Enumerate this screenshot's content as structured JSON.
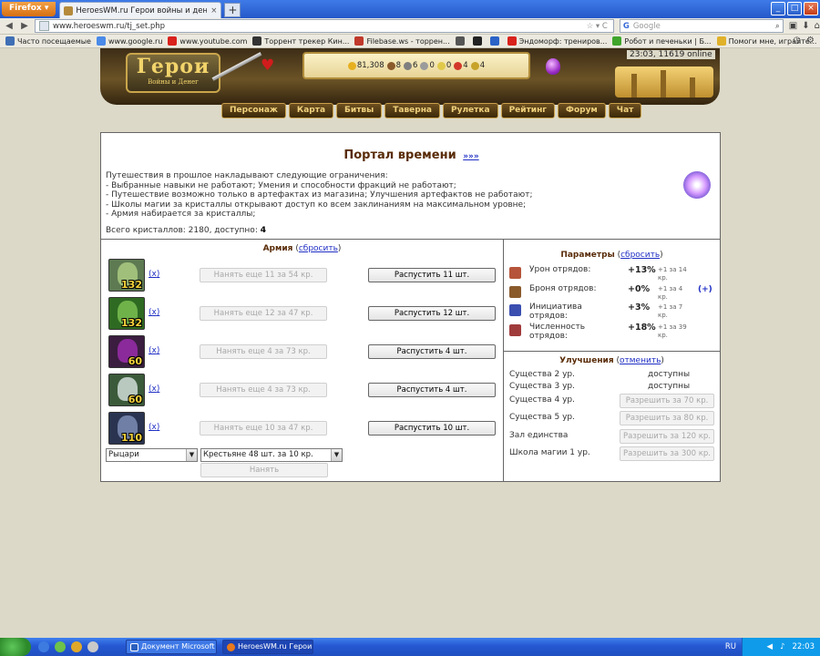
{
  "browser": {
    "app_button": "Firefox",
    "tab_title": "HeroesWM.ru Герои войны и денег. Онла...",
    "tab_close": "×",
    "new_tab": "+",
    "url": "www.heroeswm.ru/tj_set.php",
    "search_engine": "G",
    "search_placeholder": "Google",
    "bookmarks": [
      {
        "label": "Часто посещаемые",
        "color": "#3f6fb5"
      },
      {
        "label": "www.google.ru",
        "color": "#4a8ae8"
      },
      {
        "label": "www.youtube.com",
        "color": "#d9221c"
      },
      {
        "label": "Торрент трекер Кин...",
        "color": "#333333"
      },
      {
        "label": "Filebase.ws - торрен...",
        "color": "#c0392b"
      },
      {
        "label": "",
        "color": "#555555"
      },
      {
        "label": "",
        "color": "#222222"
      },
      {
        "label": "",
        "color": "#2b63c7"
      },
      {
        "label": "Эндоморф: трениров...",
        "color": "#d9221c"
      },
      {
        "label": "Робот и печеньки | Б...",
        "color": "#3fa52b"
      },
      {
        "label": "Помоги мне, играйте...",
        "color": "#e0b12a"
      }
    ]
  },
  "game": {
    "logo_title": "Герои",
    "logo_subtitle": "Войны и Денег",
    "time_online": "23:03, 11619 online",
    "resources": [
      {
        "value": "81,308",
        "color": "#e6b020"
      },
      {
        "value": "8",
        "color": "#8a5a2b"
      },
      {
        "value": "6",
        "color": "#7f7f7f"
      },
      {
        "value": "0",
        "color": "#9b9b9b"
      },
      {
        "value": "0",
        "color": "#e0c94a"
      },
      {
        "value": "4",
        "color": "#d2372a"
      },
      {
        "value": "4",
        "color": "#c7a32a"
      }
    ],
    "menu": [
      "Персонаж",
      "Карта",
      "Битвы",
      "Таверна",
      "Рулетка",
      "Рейтинг",
      "Форум",
      "Чат"
    ]
  },
  "portal": {
    "title": "Портал времени",
    "title_link": "»»»",
    "restrictions": [
      "Путешествия в прошлое накладывают следующие ограничения:",
      "- Выбранные навыки не работают; Умения и способности фракций не работают;",
      "- Путешествие возможно только в артефактах из магазина; Улучшения артефактов не работают;",
      "- Школы магии за кристаллы открывают доступ ко всем заклинаниям на максимальном уровне;",
      "- Армия набирается за кристаллы;"
    ],
    "crystals_label": "Всего кристаллов: 2180, доступно: ",
    "crystals_available": "4"
  },
  "army": {
    "title": "Армия",
    "reset_label": "сбросить",
    "remove_label": "x",
    "units": [
      {
        "count": "132",
        "hire": "Нанять еще 11 за 54 кр.",
        "disband": "Распустить 11 шт.",
        "color": "#5d7a52",
        "face": "#9fbf7a"
      },
      {
        "count": "132",
        "hire": "Нанять еще 12 за 47 кр.",
        "disband": "Распустить 12 шт.",
        "color": "#2f6a22",
        "face": "#6fb24a"
      },
      {
        "count": "60",
        "hire": "Нанять еще 4 за 73 кр.",
        "disband": "Распустить 4 шт.",
        "color": "#3a1d3f",
        "face": "#8b2a9a"
      },
      {
        "count": "60",
        "hire": "Нанять еще 4 за 73 кр.",
        "disband": "Распустить 4 шт.",
        "color": "#3b5a3a",
        "face": "#b9c9c0"
      },
      {
        "count": "110",
        "hire": "Нанять еще 10 за 47 кр.",
        "disband": "Распустить 10 шт.",
        "color": "#2a3350",
        "face": "#6f7fa5"
      }
    ],
    "faction_select": "Рыцари",
    "creature_select": "Крестьяне 48 шт. за 10 кр.",
    "hire_button": "Нанять"
  },
  "params": {
    "title": "Параметры",
    "reset_label": "сбросить",
    "items": [
      {
        "label": "Урон отрядов:",
        "value": "+13%",
        "cost": "+1 за 14 кр.",
        "plus": "",
        "color": "#b5543a"
      },
      {
        "label": "Броня отрядов:",
        "value": "+0%",
        "cost": "+1 за 4 кр.",
        "plus": "(+)",
        "color": "#8a5a2b"
      },
      {
        "label": "Инициатива отрядов:",
        "value": "+3%",
        "cost": "+1 за 7 кр.",
        "plus": "",
        "color": "#3a4fb0"
      },
      {
        "label": "Численность отрядов:",
        "value": "+18%",
        "cost": "+1 за 39 кр.",
        "plus": "",
        "color": "#a03b3b"
      }
    ]
  },
  "upgrades": {
    "title": "Улучшения",
    "cancel_label": "отменить",
    "items": [
      {
        "name": "Существа 2 ур.",
        "status": "доступны",
        "button": ""
      },
      {
        "name": "Существа 3 ур.",
        "status": "доступны",
        "button": ""
      },
      {
        "name": "Существа 4 ур.",
        "status": "",
        "button": "Разрешить за 70 кр."
      },
      {
        "name": "Существа 5 ур.",
        "status": "",
        "button": "Разрешить за 80 кр."
      },
      {
        "name": "Зал единства",
        "status": "",
        "button": "Разрешить за 120 кр."
      },
      {
        "name": "Школа магии 1 ур.",
        "status": "",
        "button": "Разрешить за 300 кр."
      }
    ]
  },
  "taskbar": {
    "tasks": [
      "Документ Microsoft ...",
      "HeroesWM.ru Герои ..."
    ],
    "lang": "RU",
    "clock": "22:03"
  }
}
